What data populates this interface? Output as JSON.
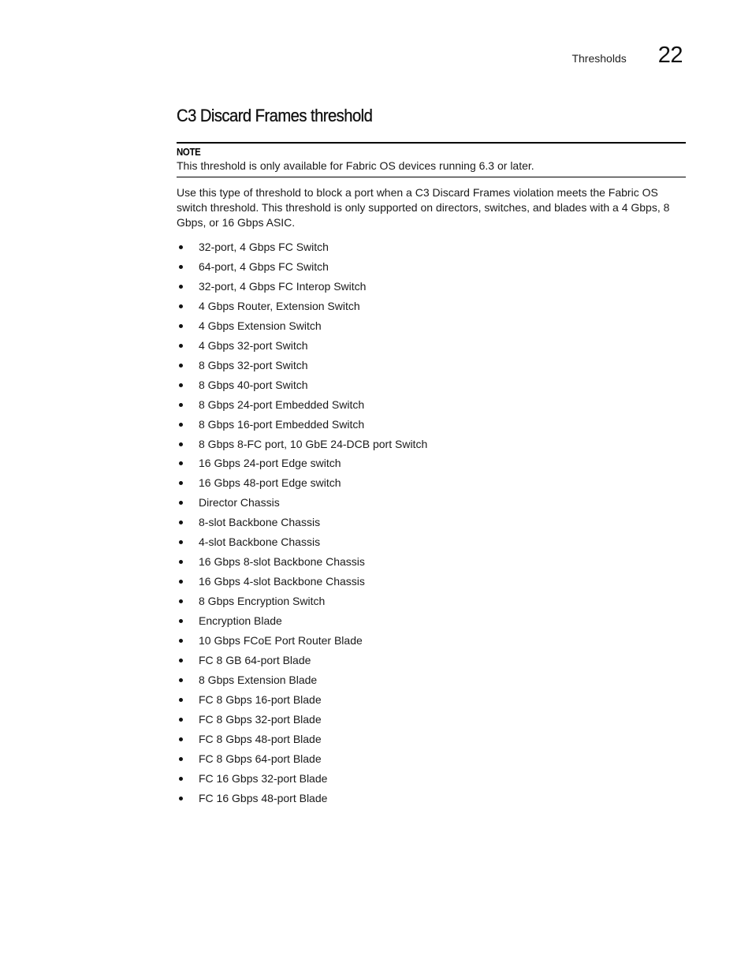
{
  "header": {
    "section_name": "Thresholds",
    "chapter_number": "22"
  },
  "section": {
    "title": "C3 Discard Frames threshold",
    "note": {
      "label": "NOTE",
      "text": "This threshold is only available for Fabric OS devices running 6.3 or later."
    },
    "paragraph": "Use this type of threshold to block a port when a C3 Discard Frames violation meets the Fabric OS switch threshold. This threshold is only supported on directors, switches, and blades with a 4 Gbps, 8 Gbps, or 16 Gbps ASIC.",
    "devices": [
      "32-port, 4 Gbps FC Switch",
      "64-port, 4 Gbps FC Switch",
      "32-port, 4 Gbps FC Interop Switch",
      "4 Gbps Router, Extension Switch",
      "4 Gbps Extension Switch",
      "4 Gbps 32-port Switch",
      "8 Gbps 32-port Switch",
      "8 Gbps 40-port Switch",
      "8 Gbps 24-port Embedded Switch",
      "8 Gbps 16-port Embedded Switch",
      "8 Gbps 8-FC port, 10 GbE 24-DCB port Switch",
      "16 Gbps 24-port Edge switch",
      "16 Gbps 48-port Edge switch",
      "Director Chassis",
      "8-slot Backbone Chassis",
      "4-slot Backbone Chassis",
      "16 Gbps 8-slot Backbone Chassis",
      "16 Gbps 4-slot Backbone Chassis",
      "8 Gbps Encryption Switch",
      "Encryption Blade",
      "10 Gbps FCoE Port Router Blade",
      "FC 8 GB 64-port Blade",
      "8 Gbps Extension Blade",
      "FC 8 Gbps 16-port Blade",
      "FC 8 Gbps 32-port Blade",
      "FC 8 Gbps 48-port Blade",
      "FC 8 Gbps 64-port Blade",
      "FC 16 Gbps 32-port Blade",
      "FC 16 Gbps 48-port Blade"
    ]
  }
}
